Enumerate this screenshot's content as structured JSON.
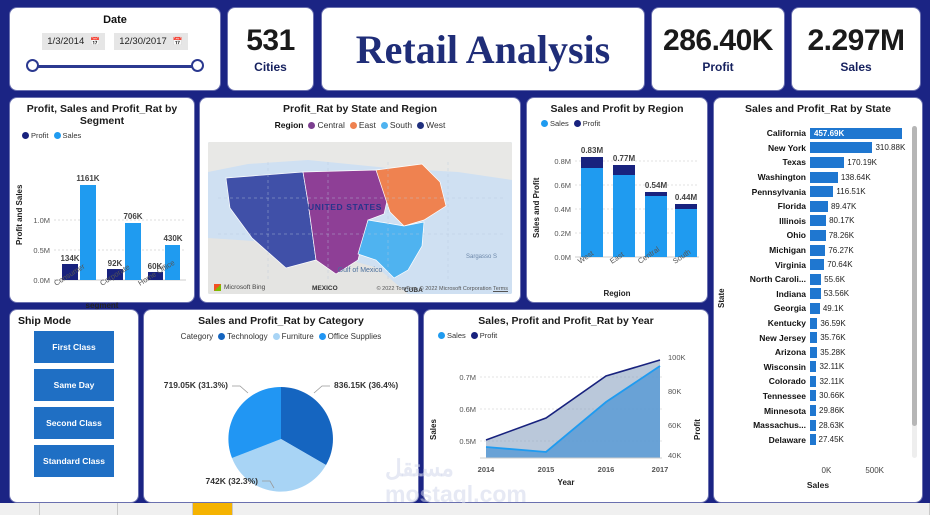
{
  "header": {
    "date_slicer": {
      "label": "Date",
      "start": "1/3/2014",
      "end": "12/30/2017",
      "calendar_icon": "calendar-icon"
    },
    "cities_kpi": {
      "value": "531",
      "label": "Cities"
    },
    "title": "Retail Analysis",
    "profit_kpi": {
      "value": "286.40K",
      "label": "Profit"
    },
    "sales_kpi": {
      "value": "2.297M",
      "label": "Sales"
    }
  },
  "segment_chart": {
    "title": "Profit, Sales and Profit_Rat by Segment",
    "legend": [
      "Profit",
      "Sales"
    ],
    "ylabel": "Profit and Sales",
    "xlabel": "segment",
    "yticks": [
      "0.0M",
      "0.5M",
      "1.0M"
    ]
  },
  "map_panel": {
    "title": "Profit_Rat by State and Region",
    "legend_label": "Region",
    "legend": [
      "Central",
      "East",
      "South",
      "West"
    ],
    "map_label": "UNITED STATES",
    "gulf_label": "Gulf of Mexico",
    "mexico_label": "MEXICO",
    "cuba_label": "CUBA",
    "sea_label": "Sargasso S",
    "provider": "Microsoft Bing",
    "attribution": "© 2022 TomTom, © 2022 Microsoft Corporation",
    "terms": "Terms"
  },
  "region_chart": {
    "title": "Sales and Profit by Region",
    "legend": [
      "Sales",
      "Profit"
    ],
    "ylabel": "Sales and Profit",
    "xlabel": "Region",
    "yticks": [
      "0.0M",
      "0.2M",
      "0.4M",
      "0.6M",
      "0.8M"
    ]
  },
  "state_chart": {
    "title": "Sales and Profit_Rat by State",
    "ylabel": "State",
    "xlabel": "Sales",
    "xticks": [
      "0K",
      "500K"
    ]
  },
  "ship_mode": {
    "title": "Ship Mode",
    "options": [
      "First Class",
      "Same Day",
      "Second Class",
      "Standard Class"
    ]
  },
  "category_chart": {
    "title": "Sales and Profit_Rat by Category",
    "legend_label": "Category",
    "legend": [
      "Technology",
      "Furniture",
      "Office Supplies"
    ],
    "labels": [
      "836.15K (36.4%)",
      "719.05K (31.3%)",
      "742K (32.3%)"
    ]
  },
  "year_chart": {
    "title": "Sales, Profit and Profit_Rat by Year",
    "legend": [
      "Sales",
      "Profit"
    ],
    "ylabel_left": "Sales",
    "ylabel_right": "Profit",
    "xlabel": "Year",
    "yticks_left": [
      "0.5M",
      "0.6M",
      "0.7M"
    ],
    "yticks_right": [
      "40K",
      "60K",
      "80K",
      "100K"
    ]
  },
  "watermark": {
    "line1": "مستقل",
    "line2": "mostaql.com"
  },
  "colors": {
    "background": "#1b2484",
    "profit_dark": "#18227e",
    "sales_blue": "#1f9bf0",
    "state_bar": "#1f77d0",
    "ship_button": "#1f6fc4",
    "title_navy": "#1f2d78",
    "region_central": "#7b3f8f",
    "region_east": "#ef8250",
    "region_south": "#4fb3f0",
    "region_west": "#4050a8",
    "tab_active": "#f5b301"
  },
  "chart_data": [
    {
      "type": "bar",
      "title": "Profit, Sales and Profit_Rat by Segment",
      "xlabel": "segment",
      "ylabel": "Profit and Sales",
      "categories": [
        "Consumer",
        "Corporate",
        "Home Office"
      ],
      "ylim": [
        0,
        1250000
      ],
      "grid": true,
      "legend_position": "top-left",
      "series": [
        {
          "name": "Profit",
          "values": [
            134000,
            92000,
            60000
          ],
          "labels": [
            "134K",
            "92K",
            "60K"
          ],
          "color": "#18227e"
        },
        {
          "name": "Sales",
          "values": [
            1161000,
            706000,
            430000
          ],
          "labels": [
            "1161K",
            "706K",
            "430K"
          ],
          "color": "#1f9bf0"
        }
      ]
    },
    {
      "type": "bar",
      "title": "Sales and Profit by Region",
      "xlabel": "Region",
      "ylabel": "Sales and Profit",
      "categories": [
        "West",
        "East",
        "Central",
        "South"
      ],
      "ylim": [
        0,
        0.9
      ],
      "grid": true,
      "stacked": true,
      "totals": [
        0.83,
        0.77,
        0.54,
        0.44
      ],
      "total_labels": [
        "0.83M",
        "0.77M",
        "0.54M",
        "0.44M"
      ],
      "series": [
        {
          "name": "Sales",
          "values": [
            0.74,
            0.685,
            0.515,
            0.405
          ],
          "color": "#1f9bf0"
        },
        {
          "name": "Profit",
          "values": [
            0.09,
            0.085,
            0.025,
            0.035
          ],
          "color": "#18227e"
        }
      ]
    },
    {
      "type": "bar",
      "orientation": "horizontal",
      "title": "Sales and Profit_Rat by State",
      "xlabel": "Sales",
      "ylabel": "State",
      "xlim": [
        0,
        500000
      ],
      "categories": [
        "California",
        "New York",
        "Texas",
        "Washington",
        "Pennsylvania",
        "Florida",
        "Illinois",
        "Ohio",
        "Michigan",
        "Virginia",
        "North Caroli...",
        "Indiana",
        "Georgia",
        "Kentucky",
        "New Jersey",
        "Arizona",
        "Wisconsin",
        "Colorado",
        "Tennessee",
        "Minnesota",
        "Massachus...",
        "Delaware"
      ],
      "values": [
        457690,
        310880,
        170190,
        138640,
        116510,
        89470,
        80170,
        78260,
        76270,
        70640,
        55600,
        53560,
        49100,
        36590,
        35760,
        35280,
        32110,
        32110,
        30660,
        29860,
        28630,
        27450
      ],
      "value_labels": [
        "457.69K",
        "310.88K",
        "170.19K",
        "138.64K",
        "116.51K",
        "89.47K",
        "80.17K",
        "78.26K",
        "76.27K",
        "70.64K",
        "55.6K",
        "53.56K",
        "49.1K",
        "36.59K",
        "35.76K",
        "35.28K",
        "32.11K",
        "32.11K",
        "30.66K",
        "29.86K",
        "28.63K",
        "27.45K"
      ]
    },
    {
      "type": "pie",
      "title": "Sales and Profit_Rat by Category",
      "legend_position": "top",
      "slices": [
        {
          "name": "Technology",
          "value": 836150,
          "percent": 36.4,
          "label": "836.15K (36.4%)",
          "color": "#1565c0"
        },
        {
          "name": "Furniture",
          "value": 742000,
          "percent": 32.3,
          "label": "742K (32.3%)",
          "color": "#a8d4f5"
        },
        {
          "name": "Office Supplies",
          "value": 719050,
          "percent": 31.3,
          "label": "719.05K (31.3%)",
          "color": "#2196f3"
        }
      ]
    },
    {
      "type": "area",
      "title": "Sales, Profit and Profit_Rat by Year",
      "xlabel": "Year",
      "x": [
        "2014",
        "2015",
        "2016",
        "2017"
      ],
      "ylabel_left": "Sales",
      "ylim_left": [
        450000,
        740000
      ],
      "ylabel_right": "Profit",
      "ylim_right": [
        38000,
        102000
      ],
      "series": [
        {
          "name": "Sales",
          "axis": "left",
          "values": [
            484000,
            470000,
            609000,
            733000
          ],
          "color": "#1f9bf0"
        },
        {
          "name": "Profit",
          "axis": "right",
          "values": [
            49500,
            61500,
            81800,
            93500
          ],
          "color": "#18227e"
        }
      ]
    },
    {
      "type": "map",
      "title": "Profit_Rat by State and Region",
      "regions": [
        {
          "name": "Central",
          "color": "#7b3f8f"
        },
        {
          "name": "East",
          "color": "#ef8250"
        },
        {
          "name": "South",
          "color": "#4fb3f0"
        },
        {
          "name": "West",
          "color": "#4050a8"
        }
      ]
    }
  ]
}
